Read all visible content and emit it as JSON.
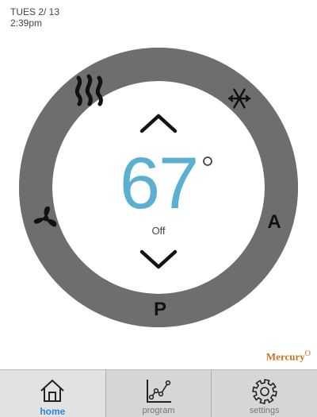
{
  "status": {
    "date": "TUES 2/ 13",
    "time": "2:39pm"
  },
  "thermostat": {
    "temperature": "67",
    "mode": "Off",
    "segments": {
      "heat": {
        "icon": "heat-icon"
      },
      "cool": {
        "icon": "snowflake-icon"
      },
      "auto": {
        "label": "A"
      },
      "program": {
        "label": "P"
      },
      "fan": {
        "icon": "fan-icon"
      }
    },
    "colors": {
      "temperature": "#5bb0d1",
      "segment": "#6e6e6e",
      "active_tab": "#2b88d6"
    }
  },
  "brand": {
    "name": "Mercury",
    "mark": "O"
  },
  "tabs": [
    {
      "label": "home",
      "icon": "home-icon",
      "active": true
    },
    {
      "label": "program",
      "icon": "chart-icon",
      "active": false
    },
    {
      "label": "settings",
      "icon": "gear-icon",
      "active": false
    }
  ]
}
